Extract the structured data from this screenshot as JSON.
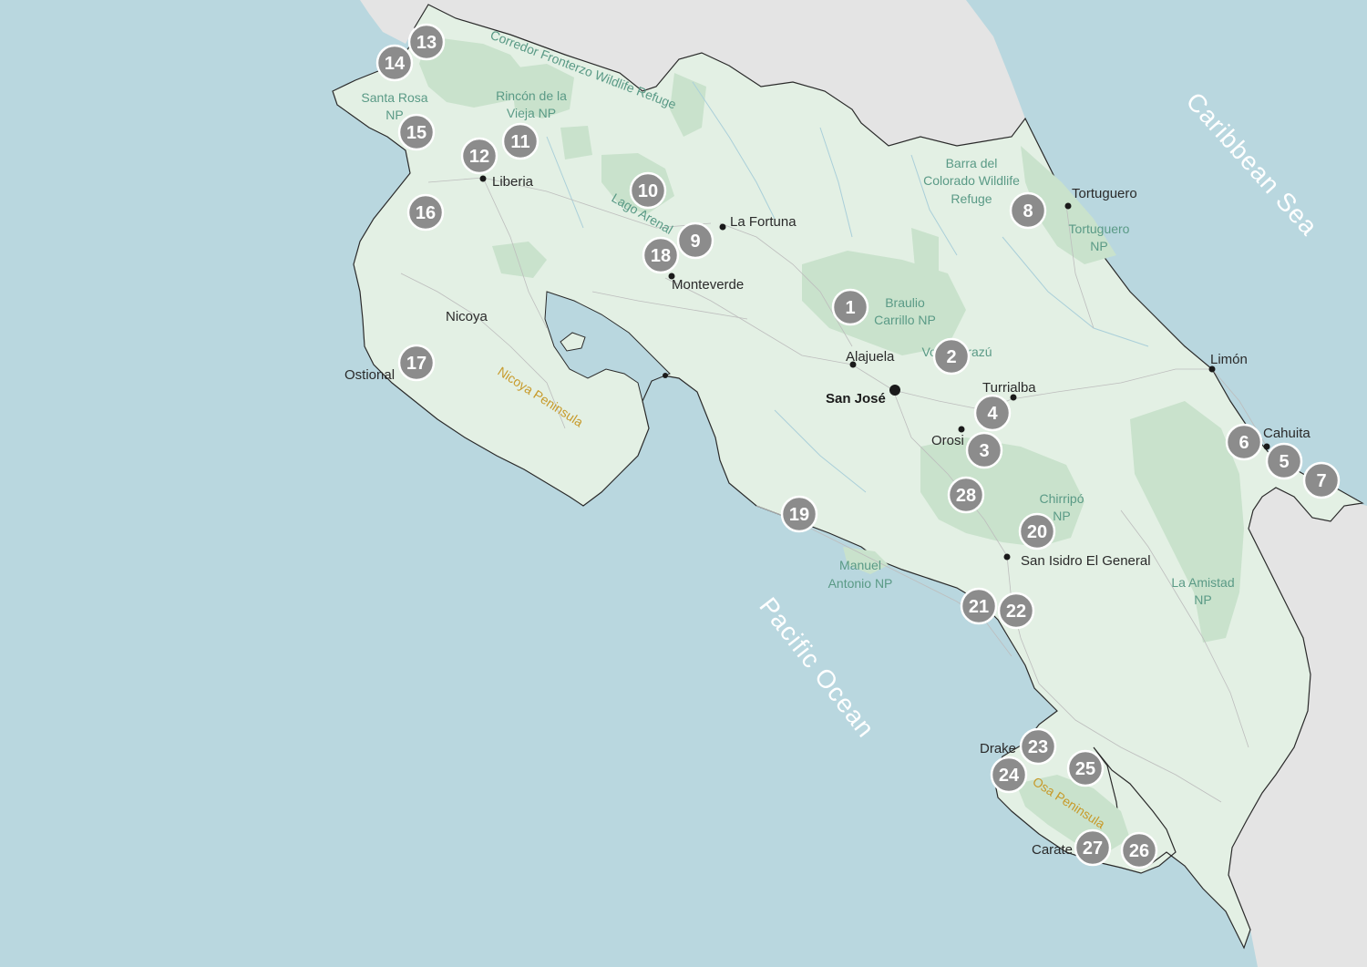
{
  "colors": {
    "water": "#b9d7df",
    "land": "#e3f0e4",
    "neighbor": "#e4e4e4",
    "park": "#c9e2cc",
    "marker": "#8c8c8c",
    "park_label": "#5a9a86",
    "peninsula_label": "#c79a2a"
  },
  "seas": {
    "caribbean": "Caribbean Sea",
    "pacific": "Pacific Ocean"
  },
  "peninsulas": {
    "nicoya": "Nicoya Peninsula",
    "osa": "Osa Peninsula"
  },
  "parks": {
    "frontier": "Corredor Fronterzo Wildlife Refuge",
    "lago_arenal": "Lago Arenal",
    "santa_rosa_1": "Santa Rosa",
    "santa_rosa_2": "NP",
    "rincon_1": "Rincón de la",
    "rincon_2": "Vieja NP",
    "barra_1": "Barra del",
    "barra_2": "Colorado Wildlife",
    "barra_3": "Refuge",
    "tortuguero_1": "Tortuguero",
    "tortuguero_2": "NP",
    "braulio_1": "Braulio",
    "braulio_2": "Carrillo NP",
    "irazu": "Volcán Irazú",
    "chirripo_1": "Chirripó",
    "chirripo_2": "NP",
    "manuel_1": "Manuel",
    "manuel_2": "Antonio NP",
    "amistad_1": "La Amistad",
    "amistad_2": "NP"
  },
  "towns": {
    "liberia": "Liberia",
    "tortuguero": "Tortuguero",
    "la_fortuna": "La Fortuna",
    "monteverde": "Monteverde",
    "nicoya": "Nicoya",
    "ostional": "Ostional",
    "alajuela": "Alajuela",
    "san_jose": "San José",
    "turrialba": "Turrialba",
    "orosi": "Orosi",
    "limon": "Limón",
    "cahuita": "Cahuita",
    "san_isidro": "San Isidro El General",
    "drake": "Drake",
    "carate": "Carate"
  },
  "markers": [
    "1",
    "2",
    "3",
    "4",
    "5",
    "6",
    "7",
    "8",
    "9",
    "10",
    "11",
    "12",
    "13",
    "14",
    "15",
    "16",
    "17",
    "18",
    "19",
    "20",
    "21",
    "22",
    "23",
    "24",
    "25",
    "26",
    "27",
    "28"
  ]
}
